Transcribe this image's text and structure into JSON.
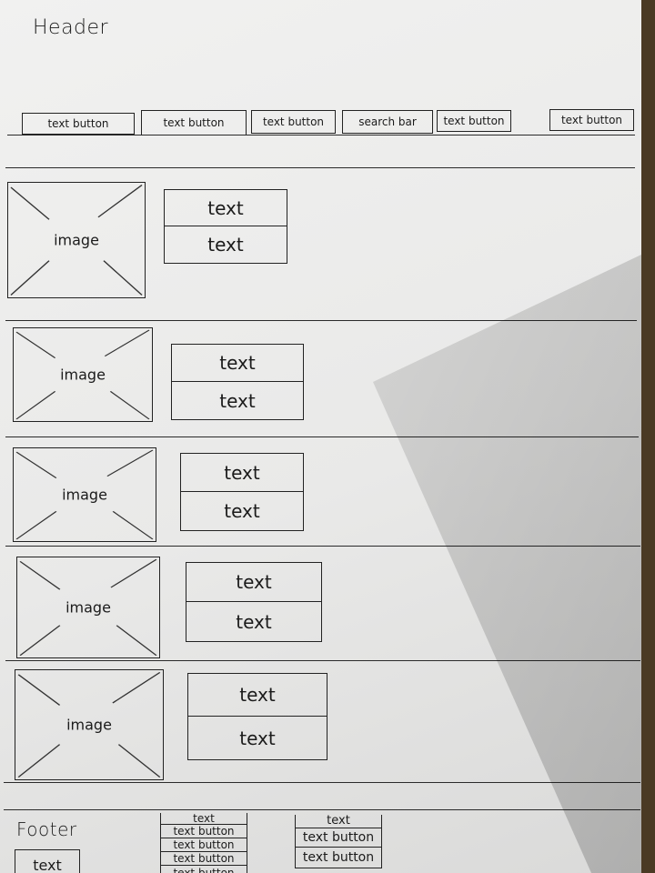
{
  "header": {
    "title": "Header"
  },
  "nav": {
    "items": [
      {
        "label": "text button"
      },
      {
        "label": "text button"
      },
      {
        "label": "text button"
      },
      {
        "label": "search bar"
      },
      {
        "label": "text button"
      },
      {
        "label": "text button"
      }
    ]
  },
  "rows": [
    {
      "image_label": "image",
      "texts": [
        "text",
        "text"
      ]
    },
    {
      "image_label": "image",
      "texts": [
        "text",
        "text"
      ]
    },
    {
      "image_label": "image",
      "texts": [
        "text",
        "text"
      ]
    },
    {
      "image_label": "image",
      "texts": [
        "text",
        "text"
      ]
    },
    {
      "image_label": "image",
      "texts": [
        "text",
        "text"
      ]
    }
  ],
  "footer": {
    "title": "Footer",
    "text_label": "text",
    "col1": [
      "text",
      "text button",
      "text button",
      "text button",
      "text button"
    ],
    "col2": [
      "text",
      "text button",
      "text button"
    ]
  }
}
